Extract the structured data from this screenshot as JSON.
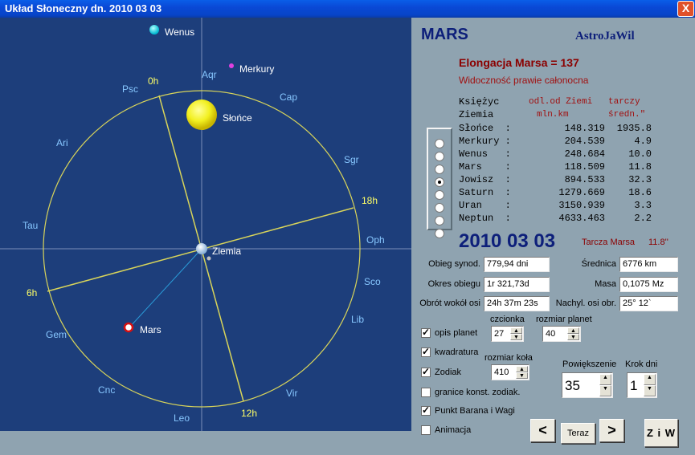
{
  "window": {
    "title": "Układ Słoneczny dn. 2010 03 03",
    "close_glyph": "X"
  },
  "chart": {
    "zodiac": [
      "Psc",
      "Aqr",
      "Cap",
      "Sgr",
      "Oph",
      "Sco",
      "Lib",
      "Vir",
      "Leo",
      "Cnc",
      "Gem",
      "Tau",
      "Ari"
    ],
    "hours": [
      "0h",
      "18h",
      "12h",
      "6h"
    ],
    "bodies": {
      "sun": "Słońce",
      "earth": "Ziemia",
      "venus": "Wenus",
      "mercury": "Merkury",
      "mars": "Mars"
    },
    "colors": {
      "background": "#1d3e7b",
      "orbit": "#d8d45a",
      "zodiac_text": "#87c7ff",
      "hour_text": "#ffff66"
    }
  },
  "panel": {
    "planet_name": "MARS",
    "app_name": "AstroJaWil",
    "elongation": "Elongacja Marsa = 137",
    "visibility": "Widoczność prawie całonocna",
    "table": {
      "head1": "Księżyc",
      "head2": "Ziemia",
      "col1_head1": "odl.od Ziemi",
      "col1_head2": "mln.km",
      "col2_head1": "tarczy",
      "col2_head2": "średn.\"",
      "rows": [
        {
          "name": "Słońce  :",
          "dist": "148.319",
          "disk": "1935.8"
        },
        {
          "name": "Merkury :",
          "dist": "204.539",
          "disk": "4.9"
        },
        {
          "name": "Wenus   :",
          "dist": "248.684",
          "disk": "10.0"
        },
        {
          "name": "Mars    :",
          "dist": "118.509",
          "disk": "11.8"
        },
        {
          "name": "Jowisz  :",
          "dist": "894.533",
          "disk": "32.3"
        },
        {
          "name": "Saturn  :",
          "dist": "1279.669",
          "disk": "18.6"
        },
        {
          "name": "Uran    :",
          "dist": "3150.939",
          "disk": "3.3"
        },
        {
          "name": "Neptun  :",
          "dist": "4633.463",
          "disk": "2.2"
        }
      ],
      "selected_index": 3
    },
    "big_date": "2010 03 03",
    "disk_label": "Tarcza Marsa",
    "disk_value": "11.8''",
    "fields": {
      "synodic_label": "Obieg synod.",
      "synodic_value": "779,94 dni",
      "period_label": "Okres obiegu",
      "period_value": "1r 321,73d",
      "rotation_label": "Obrót wokół osi",
      "rotation_value": "24h 37m 23s",
      "diameter_label": "Średnica",
      "diameter_value": "6776 km",
      "mass_label": "Masa",
      "mass_value": "0,1075 Mz",
      "tilt_label": "Nachyl. osi obr.",
      "tilt_value": "25° 12`"
    },
    "options": {
      "planet_desc": {
        "label": "opis planet",
        "checked": true
      },
      "quadrature": {
        "label": "kwadratura",
        "checked": true
      },
      "zodiac": {
        "label": "Zodiak",
        "checked": true
      },
      "zodiac_bounds": {
        "label": "granice konst. zodiak.",
        "checked": false
      },
      "aries_libra": {
        "label": "Punkt Barana i Wagi",
        "checked": true
      },
      "animation": {
        "label": "Animacja",
        "checked": false
      }
    },
    "font_label": "czcionka",
    "font_value": "27",
    "planet_size_label": "rozmiar planet",
    "planet_size_value": "40",
    "circle_size_label": "rozmiar koła",
    "circle_size_value": "410",
    "zoom_label": "Powiększenie",
    "zoom_value": "35",
    "step_label": "Krok dni",
    "step_value": "1",
    "prev_label": "<",
    "now_label": "Teraz",
    "next_label": ">",
    "ziw_label": "Z i W"
  }
}
